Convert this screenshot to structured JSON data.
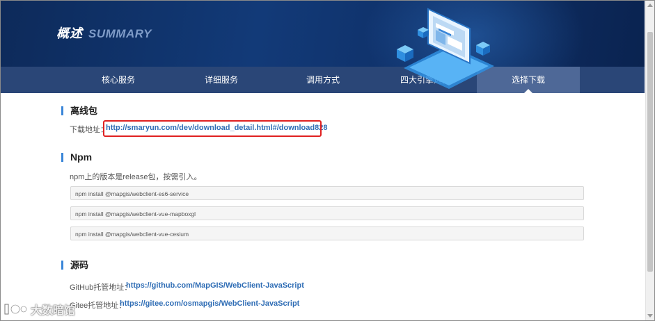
{
  "banner": {
    "title_cn": "概述",
    "title_en": "SUMMARY"
  },
  "nav": {
    "items": [
      {
        "label": "核心服务",
        "active": false
      },
      {
        "label": "详细服务",
        "active": false
      },
      {
        "label": "调用方式",
        "active": false
      },
      {
        "label": "四大引擎选择",
        "active": false
      },
      {
        "label": "选择下载",
        "active": true
      }
    ]
  },
  "offline": {
    "title": "离线包",
    "download_label": "下载地址：",
    "download_link": "http://smaryun.com/dev/download_detail.html#/download828"
  },
  "npm": {
    "title": "Npm",
    "description": "npm上的版本是release包，按需引入。",
    "commands": [
      "npm install @mapgis/webclient-es6-service",
      "npm install @mapgis/webclient-vue-mapboxgl",
      "npm install @mapgis/webclient-vue-cesium"
    ]
  },
  "source": {
    "title": "源码",
    "github_label": "GitHub托管地址：",
    "github_link": "https://github.com/MapGIS/WebClient-JavaScript",
    "gitee_label": "Gitee托管地址：",
    "gitee_link": "https://gitee.com/osmapgis/WebClient-JavaScript"
  },
  "watermark": {
    "text": "大数暗馆"
  },
  "colors": {
    "banner_bg": "#0f2f66",
    "nav_bg": "#2a4677",
    "nav_active_bg": "#4e6897",
    "link": "#2f6db5",
    "section_accent": "#3a86d8",
    "highlight_border": "#e02020"
  }
}
